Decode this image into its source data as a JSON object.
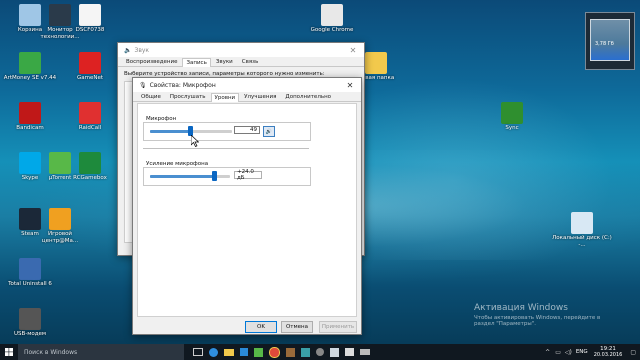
{
  "desktop": {
    "icons": [
      {
        "label": "Корзина",
        "icon": "recycle-bin-icon",
        "color": "#9fc6e6"
      },
      {
        "label": "Монитор технологии...",
        "icon": "monitor-app-icon",
        "color": "#2a3a4a"
      },
      {
        "label": "DSCF0738",
        "icon": "image-file-icon",
        "color": "#f5f5f5"
      },
      {
        "label": "ArtMoney SE v7.44",
        "icon": "artmoney-icon",
        "color": "#3aa845"
      },
      {
        "label": "GameNet",
        "icon": "gamenet-icon",
        "color": "#d22"
      },
      {
        "label": "Bandicam",
        "icon": "bandicam-icon",
        "color": "#c01818"
      },
      {
        "label": "RaidCall",
        "icon": "raidcall-icon",
        "color": "#e03030"
      },
      {
        "label": "Skype",
        "icon": "skype-icon",
        "color": "#00a8e8"
      },
      {
        "label": "µTorrent",
        "icon": "utorrent-icon",
        "color": "#58b848"
      },
      {
        "label": "RCGamebox",
        "icon": "rcgamebox-icon",
        "color": "#1e8a3c"
      },
      {
        "label": "Steam",
        "icon": "steam-icon",
        "color": "#1b2838"
      },
      {
        "label": "Игровой центр@Ma...",
        "icon": "game-center-icon",
        "color": "#f0a020"
      },
      {
        "label": "Total Uninstall 6",
        "icon": "total-uninstall-icon",
        "color": "#3a6ab0"
      },
      {
        "label": "USB-модем",
        "icon": "usb-modem-icon",
        "color": "#555"
      },
      {
        "label": "Google Chrome",
        "icon": "chrome-icon",
        "color": "#e8e8e8"
      },
      {
        "label": "Новая папка",
        "icon": "folder-icon",
        "color": "#f2c94c"
      },
      {
        "label": "Sync",
        "icon": "sync-tree-icon",
        "color": "#2f8f2f"
      },
      {
        "label": "Локальный диск (C:) -...",
        "icon": "local-disk-icon",
        "color": "#d8e8f4"
      }
    ]
  },
  "widget": {
    "text": "3,78 Гб"
  },
  "sound_window": {
    "title": "Звук",
    "tabs": [
      "Воспроизведение",
      "Запись",
      "Звуки",
      "Связь"
    ],
    "active_tab": 1,
    "instruction": "Выберите устройство записи, параметры которого нужно изменить:"
  },
  "mic_window": {
    "title": "Свойства: Микрофон",
    "tabs": [
      "Общие",
      "Прослушать",
      "Уровни",
      "Улучшения",
      "Дополнительно"
    ],
    "active_tab": 2,
    "mic_group_label": "Микрофон",
    "mic_value": "49",
    "mic_level": 49,
    "boost_group_label": "Усиление микрофона",
    "boost_value": "+24.0 дБ",
    "boost_fraction": 0.8,
    "ok": "OK",
    "cancel": "Отмена",
    "apply": "Применить"
  },
  "activation": {
    "title": "Активация Windows",
    "line1": "Чтобы активировать Windows, перейдите в",
    "line2": "раздел \"Параметры\"."
  },
  "taskbar": {
    "search_placeholder": "Поиск в Windows",
    "lang": "ENG",
    "time": "19:21",
    "date": "20.03.2016"
  }
}
